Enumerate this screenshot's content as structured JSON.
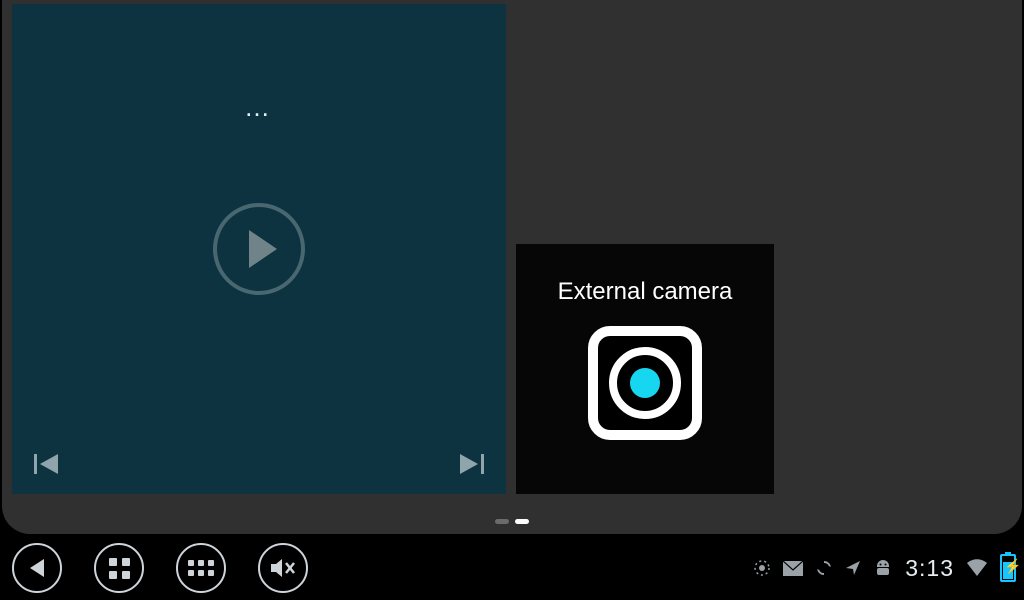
{
  "player": {
    "track_meta": "…",
    "play_button": "Play",
    "prev_button": "Previous track",
    "next_button": "Next track"
  },
  "camera_card": {
    "label": "External camera"
  },
  "pager": {
    "page_count": 2,
    "active_index": 1
  },
  "sysbar": {
    "back": "Back",
    "recents": "Recent apps",
    "apps": "All apps",
    "mute": "Mute",
    "clock": "3:13",
    "tray_icons": [
      "gps-icon",
      "mail-icon",
      "sync-icon",
      "location-icon",
      "android-icon",
      "wifi-icon",
      "battery-icon"
    ]
  }
}
